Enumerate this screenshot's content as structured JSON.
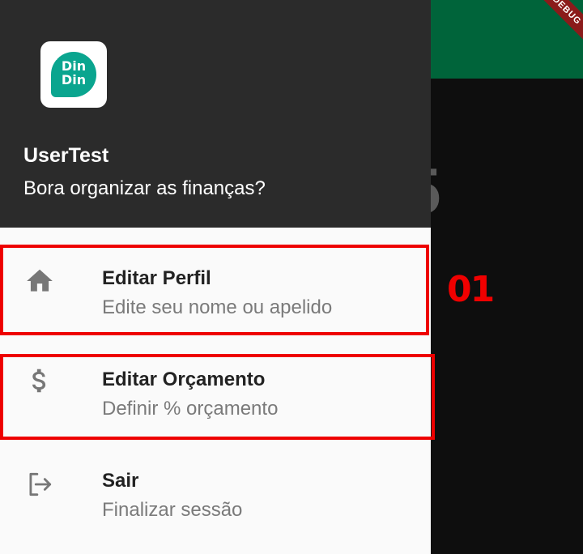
{
  "background": {
    "debug_banner": "DEBUG",
    "partial_glyph": "5",
    "appbar_color": "#00643a"
  },
  "drawer": {
    "header": {
      "logo_text": "Din\nDin",
      "logo_icon": "dindin-logo-icon",
      "user_name": "UserTest",
      "tagline": "Bora organizar as finanças?"
    },
    "items": [
      {
        "icon": "home-icon",
        "title": "Editar Perfil",
        "subtitle": "Edite seu nome ou apelido"
      },
      {
        "icon": "dollar-icon",
        "title": "Editar Orçamento",
        "subtitle": "Definir % orçamento"
      },
      {
        "icon": "logout-icon",
        "title": "Sair",
        "subtitle": "Finalizar sessão"
      }
    ]
  },
  "annotation": {
    "label": "01",
    "color": "#ee0000"
  }
}
